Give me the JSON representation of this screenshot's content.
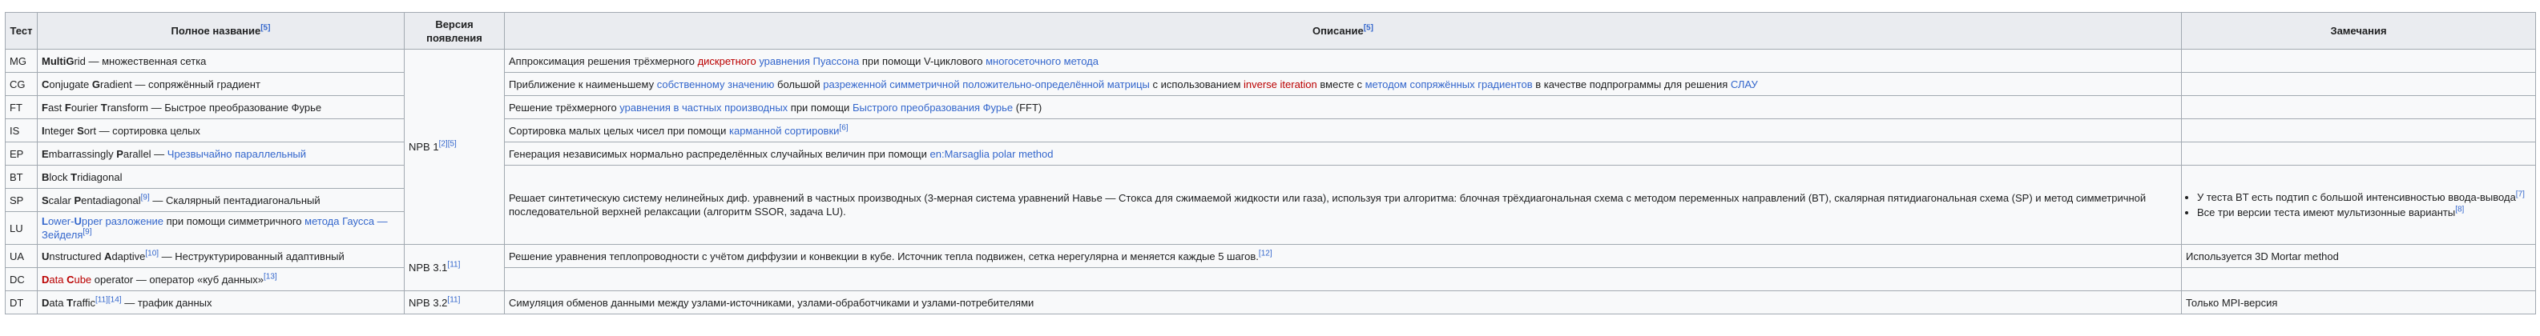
{
  "headers": {
    "test": "Тест",
    "full_name": "Полное название",
    "full_name_ref": "[5]",
    "version": "Версия появления",
    "description": "Описание",
    "description_ref": "[5]",
    "notes": "Замечания"
  },
  "rows": {
    "mg": {
      "code": "MG",
      "name_b1": "Multi",
      "name_p1": "",
      "name_b2": "G",
      "name_p2": "rid — множественная сетка",
      "desc_p1": "Аппроксимация решения трёхмерного ",
      "desc_red1": "дискретного",
      "desc_p2": " ",
      "desc_lk1": "уравнения Пуассона",
      "desc_p3": " при помощи V-циклового ",
      "desc_lk2": "многосеточного метода"
    },
    "cg": {
      "code": "CG",
      "name_b1": "C",
      "name_p1": "onjugate ",
      "name_b2": "G",
      "name_p2": "radient — сопряжённый градиент",
      "desc_p1": "Приближение к наименьшему ",
      "desc_lk1": "собственному значению",
      "desc_p2": " большой ",
      "desc_lk2": "разреженной симметричной положительно-определённой матрицы",
      "desc_p3": " с использованием ",
      "desc_red1": "inverse iteration",
      "desc_p4": " вместе с ",
      "desc_lk3": "методом сопряжённых градиентов",
      "desc_p5": " в качестве подпрограммы для решения ",
      "desc_lk4": "СЛАУ"
    },
    "ft": {
      "code": "FT",
      "name_b1": "F",
      "name_p1": "ast ",
      "name_b2": "F",
      "name_p2": "ourier ",
      "name_b3": "T",
      "name_p3": "ransform — Быстрое преобразование Фурье",
      "desc_p1": "Решение трёхмерного ",
      "desc_lk1": "уравнения в частных производных",
      "desc_p2": " при помощи ",
      "desc_lk2": "Быстрого преобразования Фурье",
      "desc_p3": " (FFT)"
    },
    "is": {
      "code": "IS",
      "name_b1": "I",
      "name_p1": "nteger ",
      "name_b2": "S",
      "name_p2": "ort — сортировка целых",
      "desc_p1": "Сортировка малых целых чисел при помощи ",
      "desc_lk1": "карманной сортировки",
      "desc_ref": "[6]"
    },
    "ep": {
      "code": "EP",
      "name_b1": "E",
      "name_p1": "mbarrassingly ",
      "name_b2": "P",
      "name_p2": "arallel — ",
      "name_lk": "Чрезвычайно параллельный",
      "desc_p1": "Генерация независимых нормально распределённых случайных величин при помощи ",
      "desc_lk1": "en:Marsaglia polar method"
    },
    "bt": {
      "code": "BT",
      "name_b1": "B",
      "name_p1": "lock ",
      "name_b2": "T",
      "name_p2": "ridiagonal"
    },
    "sp": {
      "code": "SP",
      "name_b1": "S",
      "name_p1": "calar ",
      "name_b2": "P",
      "name_p2": "entadiagonal",
      "name_ref": "[9]",
      "name_p3": " — Скалярный пентадиагональный"
    },
    "lu": {
      "code": "LU",
      "name_lk_b1": "L",
      "name_lk1": "ower-",
      "name_lk_b2": "U",
      "name_lk2": "pper разложение",
      "name_p1": " при помощи симметричного ",
      "name_lk3": "метода Гаусса — Зейделя",
      "name_ref": "[9]"
    },
    "bt_sp_lu_desc": "Решает синтетическую систему нелинейных диф. уравнений в частных производных (3-мерная система уравнений Навье — Стокса для сжимаемой жидкости или газа), используя три алгоритма: блочная трёхдиагональная схема с методом переменных направлений (BT), скалярная пятидиагональная схема (SP) и метод симметричной последовательной верхней релаксации (алгоритм SSOR, задача LU).",
    "bt_sp_lu_notes": {
      "item1": "У теста BT есть подтип с большой интенсивностью ввода-вывода",
      "item1_ref": "[7]",
      "item2": "Все три версии теста имеют мультизонные варианты",
      "item2_ref": "[8]"
    },
    "ua": {
      "code": "UA",
      "name_b1": "U",
      "name_p1": "nstructured ",
      "name_b2": "A",
      "name_p2": "daptive",
      "name_ref": "[10]",
      "name_p3": " — Неструктурированный адаптивный",
      "desc_p1": "Решение уравнения теплопроводности с учётом диффузии и конвекции в кубе. Источник тепла подвижен, сетка нерегулярна и меняется каждые 5 шагов.",
      "desc_ref": "[12]",
      "notes": "Используется 3D Mortar method"
    },
    "dc": {
      "code": "DC",
      "name_red_b1": "D",
      "name_red1": "ata ",
      "name_red_b2": "C",
      "name_red2": "ube",
      "name_p1": " operator — оператор «куб данных»",
      "name_ref": "[13]"
    },
    "dt": {
      "code": "DT",
      "name_b1": "D",
      "name_p1": "ata ",
      "name_b2": "T",
      "name_p2": "raffic",
      "name_ref": "[11][14]",
      "name_p3": " — трафик данных",
      "version": "NPB 3.2",
      "version_ref": "[11]",
      "desc": "Симуляция обменов данными между узлами-источниками, узлами-обработчиками и узлами-потребителями",
      "notes": "Только MPI-версия"
    }
  },
  "versions": {
    "npb1": "NPB 1",
    "npb1_ref": "[2][5]",
    "npb31": "NPB 3.1",
    "npb31_ref": "[11]"
  },
  "colors": {
    "link": "#3366cc",
    "redlink": "#ba0000",
    "header_bg": "#eaecf0",
    "cell_bg": "#f8f9fa",
    "border": "#a2a9b1"
  }
}
